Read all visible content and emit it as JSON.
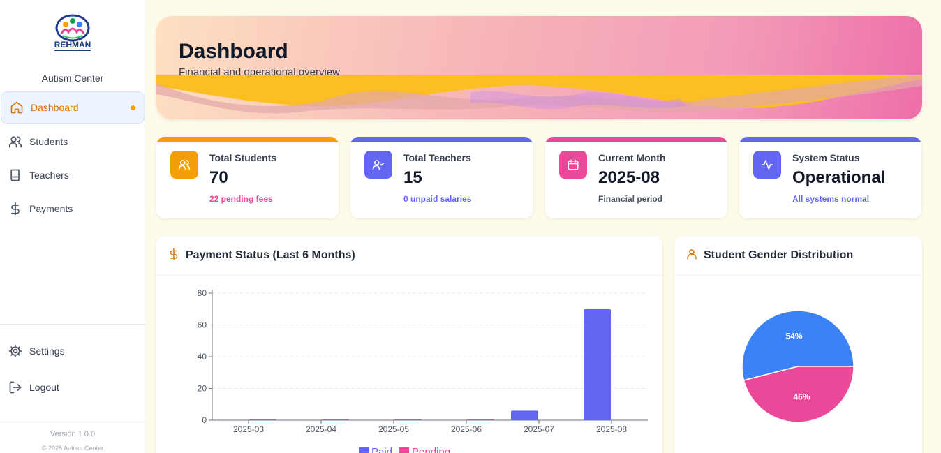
{
  "sidebar": {
    "logo_text": "REHMAN",
    "org_name": "Autism Center",
    "nav": [
      {
        "label": "Dashboard",
        "icon": "home-icon",
        "active": true
      },
      {
        "label": "Students",
        "icon": "users-icon"
      },
      {
        "label": "Teachers",
        "icon": "book-icon"
      },
      {
        "label": "Payments",
        "icon": "dollar-icon"
      }
    ],
    "bottom": [
      {
        "label": "Settings",
        "icon": "gear-icon"
      },
      {
        "label": "Logout",
        "icon": "logout-icon"
      }
    ],
    "version": "Version 1.0.0",
    "copyright": "© 2025 Autism Center"
  },
  "hero": {
    "title": "Dashboard",
    "subtitle": "Financial and operational overview"
  },
  "stats": [
    {
      "label": "Total Students",
      "value": "70",
      "sub": "22 pending fees",
      "color": "#f59e0b",
      "sub_color": "#ec4899",
      "icon": "users-icon"
    },
    {
      "label": "Total Teachers",
      "value": "15",
      "sub": "0 unpaid salaries",
      "color": "#6366f1",
      "sub_color": "#6366f1",
      "icon": "user-check-icon"
    },
    {
      "label": "Current Month",
      "value": "2025-08",
      "sub": "Financial period",
      "color": "#ec4899",
      "sub_color": "#4b5563",
      "icon": "calendar-icon"
    },
    {
      "label": "System Status",
      "value": "Operational",
      "sub": "All systems normal",
      "color": "#6366f1",
      "sub_color": "#6366f1",
      "icon": "activity-icon"
    }
  ],
  "panels": {
    "payment_title": "Payment Status (Last 6 Months)",
    "gender_title": "Student Gender Distribution"
  },
  "chart_data": [
    {
      "type": "bar",
      "title": "Payment Status (Last 6 Months)",
      "categories": [
        "2025-03",
        "2025-04",
        "2025-05",
        "2025-06",
        "2025-07",
        "2025-08"
      ],
      "series": [
        {
          "name": "Paid",
          "values": [
            0,
            0,
            0,
            0,
            6,
            70
          ],
          "color": "#6366f1"
        },
        {
          "name": "Pending",
          "values": [
            0.5,
            0.5,
            0.5,
            0.5,
            0,
            0
          ],
          "color": "#ec4899"
        }
      ],
      "ylim": [
        0,
        80
      ],
      "yticks": [
        0,
        20,
        40,
        60,
        80
      ],
      "grid": true,
      "legend": "bottom"
    },
    {
      "type": "pie",
      "title": "Student Gender Distribution",
      "slices": [
        {
          "label": "54%",
          "value": 54,
          "color": "#3b82f6"
        },
        {
          "label": "46%",
          "value": 46,
          "color": "#ec4899"
        }
      ]
    }
  ]
}
